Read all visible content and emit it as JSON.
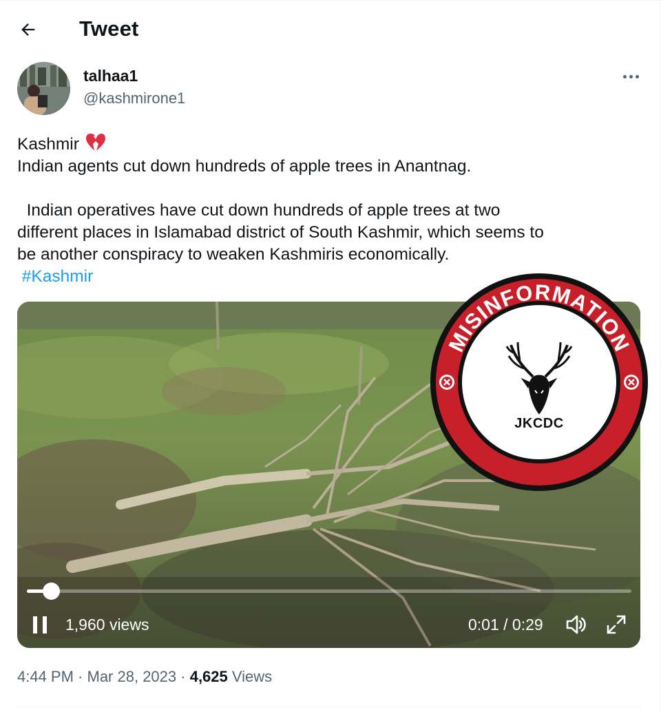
{
  "header": {
    "title": "Tweet",
    "back_icon": "arrow-left-icon"
  },
  "author": {
    "display_name": "talhaa1",
    "handle": "@kashmirone1",
    "more_icon": "more-horizontal-icon"
  },
  "tweet": {
    "line1": "Kashmir",
    "line1_icon": "broken-heart-icon",
    "line2": "Indian agents cut down hundreds of apple trees in Anantnag.",
    "paragraph_lines": [
      "  Indian operatives have cut down hundreds of apple trees at two",
      "different places in Islamabad district of South Kashmir, which seems to",
      "be another conspiracy to weaken Kashmiris economically."
    ],
    "hashtag": " #Kashmir"
  },
  "video": {
    "views": "1,960 views",
    "time": "0:01 / 0:29",
    "progress": 0.04,
    "pause_icon": "pause-icon",
    "volume_icon": "volume-icon",
    "fullscreen_icon": "fullscreen-icon"
  },
  "overlay_badge": {
    "top_text": "MISINFORMATION",
    "label": "JKCDC",
    "icon": "deer-head-icon",
    "colors": {
      "ring": "#c8202a",
      "outline": "#111111",
      "center": "#ffffff"
    }
  },
  "meta": {
    "time": "4:44 PM",
    "sep1": " · ",
    "date": "Mar 28, 2023",
    "sep2": " · ",
    "views_count": "4,625",
    "views_label": " Views"
  },
  "colors": {
    "link": "#1d9bf0",
    "secondary_text": "#536471",
    "primary_text": "#0f1419"
  }
}
